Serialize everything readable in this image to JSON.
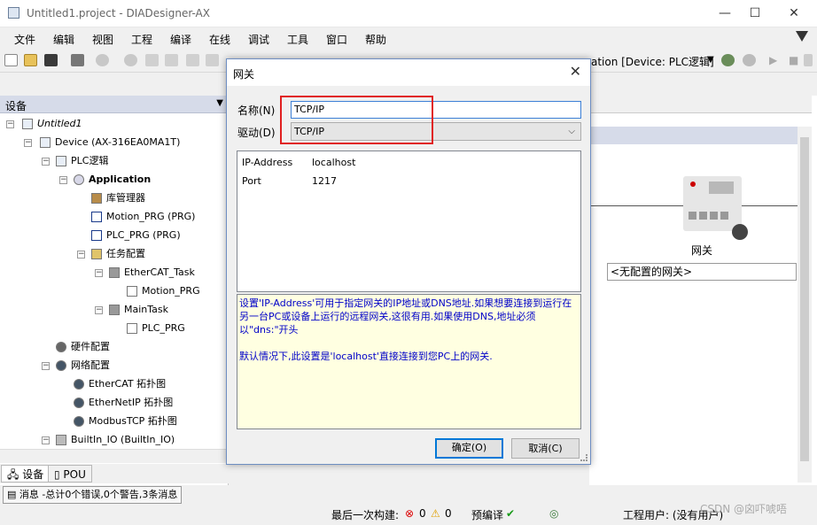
{
  "window": {
    "title": "Untitled1.project - DIADesigner-AX"
  },
  "menu": [
    "文件",
    "编辑",
    "视图",
    "工程",
    "编译",
    "在线",
    "调试",
    "工具",
    "窗口",
    "帮助"
  ],
  "toolbar": {
    "device_text": "ation [Device: PLC逻辑]"
  },
  "left_panel": {
    "header": "设备",
    "tree": [
      {
        "label": "Untitled1"
      },
      {
        "label": "Device (AX-316EA0MA1T)"
      },
      {
        "label": "PLC逻辑"
      },
      {
        "label": "Application"
      },
      {
        "label": "库管理器"
      },
      {
        "label": "Motion_PRG (PRG)"
      },
      {
        "label": "PLC_PRG (PRG)"
      },
      {
        "label": "任务配置"
      },
      {
        "label": "EtherCAT_Task"
      },
      {
        "label": "Motion_PRG"
      },
      {
        "label": "MainTask"
      },
      {
        "label": "PLC_PRG"
      },
      {
        "label": "硬件配置"
      },
      {
        "label": "网络配置"
      },
      {
        "label": "EtherCAT 拓扑图"
      },
      {
        "label": "EtherNetIP 拓扑图"
      },
      {
        "label": "ModbusTCP 拓扑图"
      },
      {
        "label": "BuiltIn_IO (BuiltIn_IO)"
      }
    ],
    "tabs": [
      "设备",
      "POU"
    ]
  },
  "gateway_panel": {
    "label": "网关",
    "select_value": "<无配置的网关>"
  },
  "dialog": {
    "title": "网关",
    "name_label": "名称(N)",
    "name_value": "TCP/IP",
    "driver_label": "驱动(D)",
    "driver_value": "TCP/IP",
    "properties": [
      {
        "key": "IP-Address",
        "value": "localhost"
      },
      {
        "key": "Port",
        "value": "1217"
      }
    ],
    "description_1": "设置'IP-Address'可用于指定网关的IP地址或DNS地址.如果想要连接到运行在另一台PC或设备上运行的远程网关,这很有用.如果使用DNS,地址必须以\"dns:\"开头",
    "description_2": "默认情况下,此设置是'localhost'直接连接到您PC上的网关.",
    "ok_label": "确定(O)",
    "cancel_label": "取消(C)",
    "highlight_color": "#e02020"
  },
  "status": {
    "messages": "消息 -总计0个错误,0个警告,3条消息",
    "last_build": "最后一次构建:",
    "errors": "0",
    "warnings": "0",
    "precompile": "预编译",
    "user": "工程用户: (没有用户)",
    "watermark": "CSDN @囟吓唬唔"
  }
}
